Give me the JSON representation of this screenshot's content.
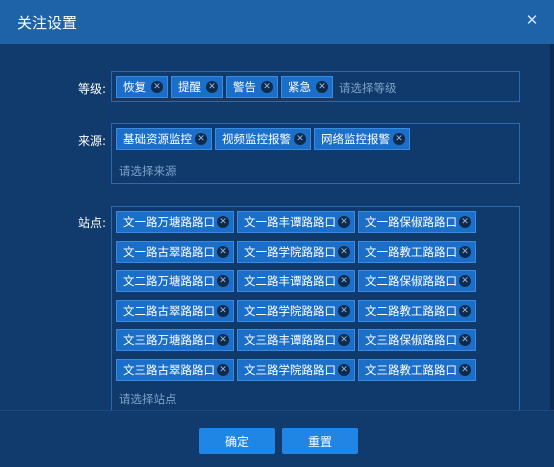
{
  "dialog": {
    "title": "关注设置",
    "close_glyph": "✕"
  },
  "level": {
    "label": "等级:",
    "tags": [
      "恢复",
      "提醒",
      "警告",
      "紧急"
    ],
    "placeholder": "请选择等级"
  },
  "source": {
    "label": "来源:",
    "tags": [
      "基础资源监控",
      "视频监控报警",
      "网络监控报警"
    ],
    "placeholder": "请选择来源"
  },
  "site": {
    "label": "站点:",
    "tags": [
      "文一路万塘路路口",
      "文一路丰谭路路口",
      "文一路保俶路路口",
      "文一路古翠路路口",
      "文一路学院路路口",
      "文一路教工路路口",
      "文二路万塘路路口",
      "文二路丰谭路路口",
      "文二路保俶路路口",
      "文二路古翠路路口",
      "文二路学院路路口",
      "文二路教工路路口",
      "文三路万塘路路口",
      "文三路丰谭路路口",
      "文三路保俶路路口",
      "文三路古翠路路口",
      "文三路学院路路口",
      "文三路教工路路口"
    ],
    "placeholder": "请选择站点"
  },
  "footer": {
    "confirm_label": "确定",
    "reset_label": "重置"
  },
  "tag_remove_glyph": "✕",
  "colors": {
    "accent": "#1f86e6",
    "panel": "#103b6c",
    "tag": "#1c6fc9"
  }
}
